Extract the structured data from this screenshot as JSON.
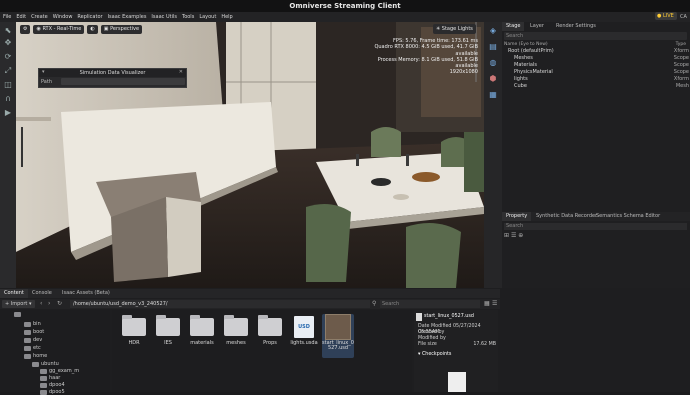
{
  "app": {
    "title": "Omniverse Streaming Client",
    "live_label": "LIVE",
    "corner_label": "CA"
  },
  "menu": [
    "File",
    "Edit",
    "Create",
    "Window",
    "Replicator",
    "Isaac Examples",
    "Isaac Utils",
    "Tools",
    "Layout",
    "Help"
  ],
  "viewport": {
    "render_mode": "RTX - Real-Time",
    "camera": "Perspective",
    "stage_lights": "Stage Lights",
    "stats": [
      "FPS: 5.76, Frame time: 173.61 ms",
      "Quadro RTX 8000: 4.5 GiB used, 41.7 GiB available",
      "Process Memory: 8.1 GiB used, 51.8 GiB available",
      "1920x1080"
    ]
  },
  "sdv": {
    "title": "Simulation Data Visualizer",
    "path_label": "Path"
  },
  "stage": {
    "tabs": [
      "Stage",
      "Layer",
      "Render Settings"
    ],
    "search_placeholder": "Search",
    "col_name": "Name (Eye to New)",
    "col_type": "Type",
    "rows": [
      {
        "name": "Root (defaultPrim)",
        "type": "Xform"
      },
      {
        "name": "Meshes",
        "type": "Scope"
      },
      {
        "name": "Materials",
        "type": "Scope"
      },
      {
        "name": "PhysicsMaterial",
        "type": "Scope"
      },
      {
        "name": "lights",
        "type": "Xform"
      },
      {
        "name": "Cube",
        "type": "Mesh"
      }
    ]
  },
  "property": {
    "tabs": [
      "Property",
      "Synthetic Data Recorder",
      "Semantics Schema Editor"
    ],
    "search_placeholder": "Search"
  },
  "content": {
    "tabs": [
      "Content",
      "Console",
      "Isaac Assets (Beta)"
    ],
    "import_label": "Import",
    "path": "/home/ubuntu/usd_demo_v3_240527/",
    "search_placeholder": "Search",
    "tree": [
      "bin",
      "boot",
      "dev",
      "etc",
      "home",
      "ubuntu",
      "gg_exam_m",
      "haar",
      "dpoo4",
      "dpoo5"
    ],
    "files": [
      {
        "name": "HDR",
        "kind": "folder"
      },
      {
        "name": "IES",
        "kind": "folder"
      },
      {
        "name": "materials",
        "kind": "folder"
      },
      {
        "name": "meshes",
        "kind": "folder"
      },
      {
        "name": "Props",
        "kind": "folder"
      },
      {
        "name": "lights.usda",
        "kind": "usd",
        "badge": "USD"
      },
      {
        "name": "start_linux_0527.usd",
        "kind": "image"
      }
    ]
  },
  "fileinfo": {
    "filename": "start_linux_0527.usd",
    "date_label": "Date Modified",
    "date": "05/27/2024 06:55AM",
    "created_label": "Created by",
    "modified_label": "Modified by",
    "size_label": "File size",
    "size": "17.62 MB",
    "checkpoints": "Checkpoints"
  }
}
